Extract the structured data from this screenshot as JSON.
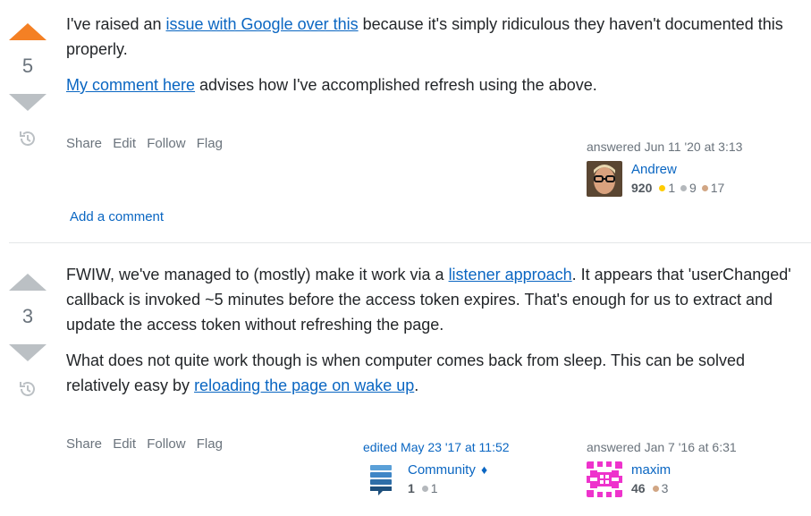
{
  "answers": [
    {
      "vote_count": "5",
      "upvoted": true,
      "paragraphs": [
        {
          "parts": [
            {
              "text": "I've raised an "
            },
            {
              "text": "issue with Google over this",
              "link": true
            },
            {
              "text": " because it's simply ridiculous they haven't documented this properly."
            }
          ]
        },
        {
          "parts": [
            {
              "text": "My comment here",
              "link": true
            },
            {
              "text": " advises how I've accomplished refresh using the above."
            }
          ]
        }
      ],
      "menu": [
        "Share",
        "Edit",
        "Follow",
        "Flag"
      ],
      "answered": {
        "action": "answered Jun 11 '20 at 3:13",
        "name": "Andrew",
        "reputation": "920",
        "gold": "1",
        "silver": "9",
        "bronze": "17"
      },
      "add_comment": "Add a comment"
    },
    {
      "vote_count": "3",
      "upvoted": false,
      "paragraphs": [
        {
          "parts": [
            {
              "text": "FWIW, we've managed to (mostly) make it work via a "
            },
            {
              "text": "listener approach",
              "link": true
            },
            {
              "text": ". It appears that 'userChanged' callback is invoked ~5 minutes before the access token expires. That's enough for us to extract and update the access token without refreshing the page."
            }
          ]
        },
        {
          "parts": [
            {
              "text": "What does not quite work though is when computer comes back from sleep. This can be solved relatively easy by "
            },
            {
              "text": "reloading the page on wake up",
              "link": true
            },
            {
              "text": "."
            }
          ]
        }
      ],
      "menu": [
        "Share",
        "Edit",
        "Follow",
        "Flag"
      ],
      "edited": {
        "action": "edited May 23 '17 at 11:52",
        "name": "Community",
        "moderator_mark": "♦",
        "reputation": "1",
        "silver": "1"
      },
      "answered": {
        "action": "answered Jan 7 '16 at 6:31",
        "name": "maxim",
        "reputation": "46",
        "bronze": "3"
      }
    }
  ]
}
